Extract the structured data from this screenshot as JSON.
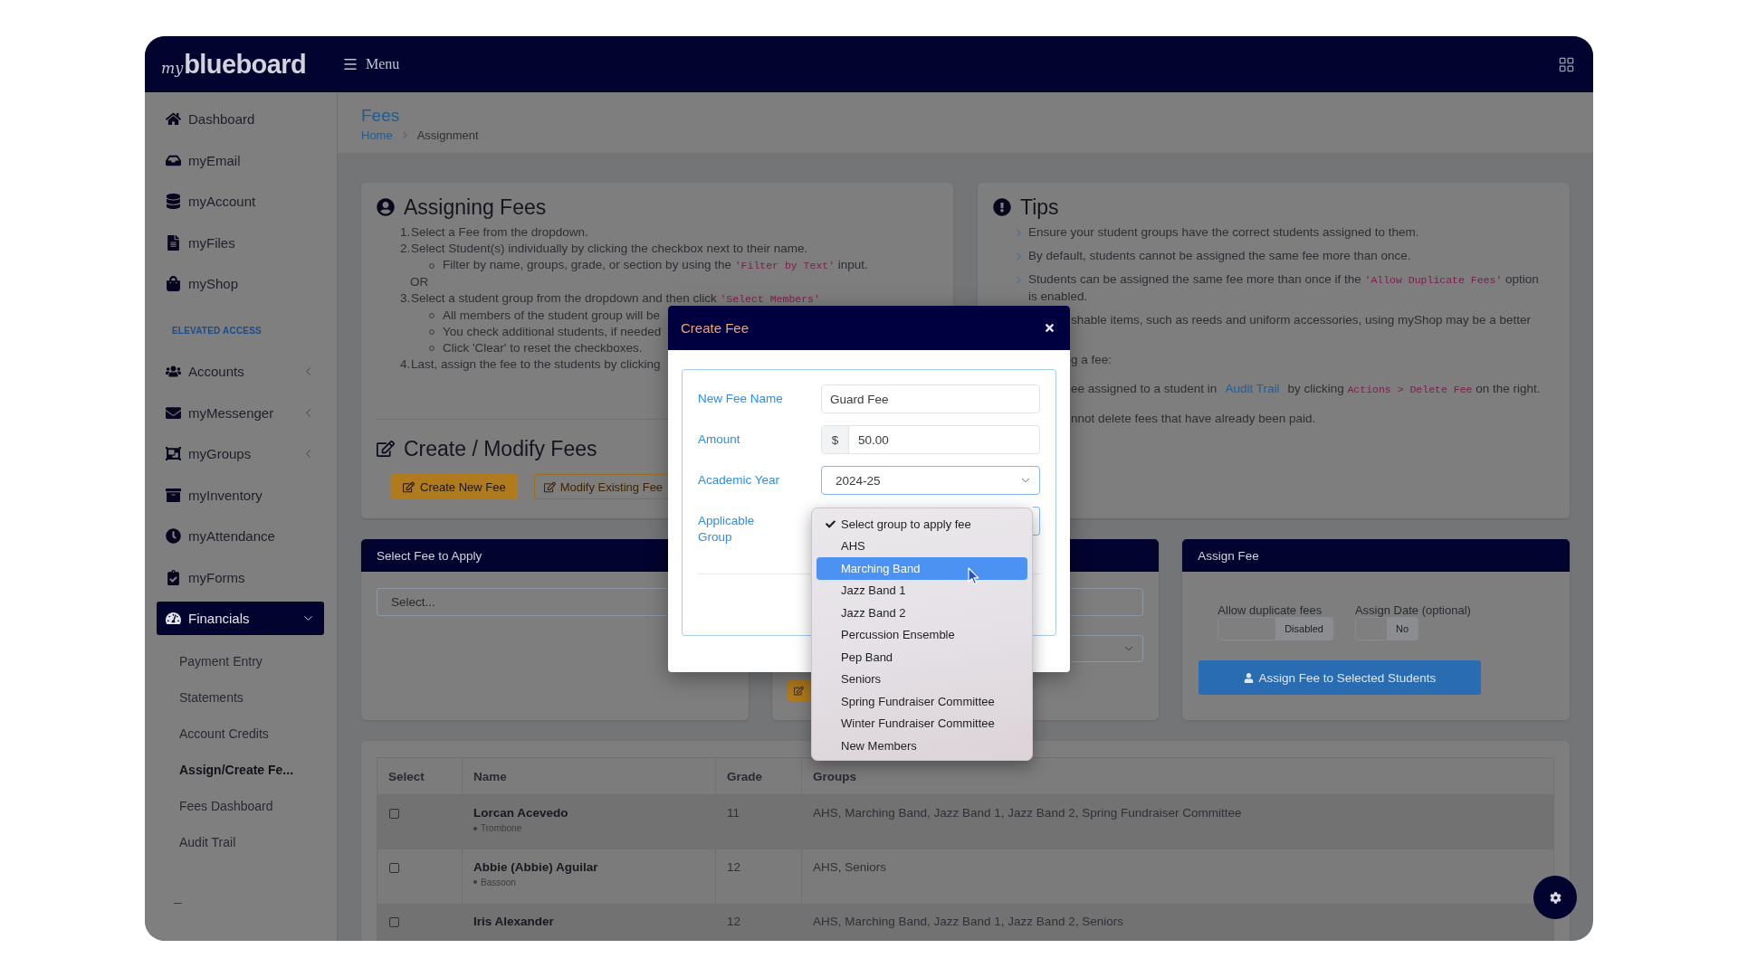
{
  "header": {
    "logo": {
      "prefix": "my",
      "name": "blueboard"
    },
    "menu_label": "Menu"
  },
  "sidebar": {
    "items": [
      {
        "label": "Dashboard",
        "selected": false
      },
      {
        "label": "myEmail",
        "selected": false
      },
      {
        "label": "myAccount",
        "selected": false
      },
      {
        "label": "myFiles",
        "selected": false
      },
      {
        "label": "myShop",
        "selected": false
      }
    ],
    "section_title": "ELEVATED ACCESS",
    "elevated_items": [
      {
        "kind": "menu",
        "label": "Accounts",
        "selected": false,
        "expanded": false
      },
      {
        "kind": "menu",
        "label": "myMessenger",
        "selected": false,
        "expanded": false
      },
      {
        "kind": "menu",
        "label": "myGroups",
        "selected": false,
        "expanded": false
      },
      {
        "kind": "link",
        "label": "myInventory",
        "selected": false
      },
      {
        "kind": "link",
        "label": "myAttendance",
        "selected": false
      },
      {
        "kind": "link",
        "label": "myForms",
        "selected": false
      },
      {
        "kind": "menu",
        "label": "Financials",
        "selected": true,
        "expanded": true,
        "children": [
          {
            "label": "Payment Entry",
            "selected": false
          },
          {
            "label": "Statements",
            "selected": false
          },
          {
            "label": "Account Credits",
            "selected": false
          },
          {
            "label": "Assign/Create Fe...",
            "selected": true
          },
          {
            "label": "Fees Dashboard",
            "selected": false
          },
          {
            "label": "Audit Trail",
            "selected": false
          }
        ]
      }
    ]
  },
  "page": {
    "title": "Fees",
    "breadcrumb": [
      {
        "kind": "link",
        "label": "Home"
      },
      {
        "kind": "current",
        "label": "Assignment"
      }
    ]
  },
  "assigning_fees": {
    "title": "Assigning Fees",
    "steps": [
      {
        "kind": "step",
        "number": "1.",
        "parts": [
          {
            "kind": "text",
            "text": "Select a Fee from the dropdown."
          }
        ]
      },
      {
        "kind": "step",
        "number": "2.",
        "parts": [
          {
            "kind": "text",
            "text": "Select Student(s) individually by clicking the checkbox next to their name."
          }
        ]
      },
      {
        "kind": "sub",
        "parts": [
          {
            "kind": "text",
            "text": "Filter by name, groups, grade, or section by using the "
          },
          {
            "kind": "code",
            "text": "'Filter by Text'"
          },
          {
            "kind": "text",
            "text": " input."
          }
        ]
      },
      {
        "kind": "note",
        "parts": [
          {
            "kind": "text",
            "text": "OR"
          }
        ]
      },
      {
        "kind": "step",
        "number": "3.",
        "parts": [
          {
            "kind": "text",
            "text": "Select a student group from the dropdown and then click "
          },
          {
            "kind": "code",
            "text": "'Select Members'"
          }
        ]
      },
      {
        "kind": "sub",
        "parts": [
          {
            "kind": "text",
            "text": "All members of the student group will be"
          }
        ]
      },
      {
        "kind": "sub",
        "parts": [
          {
            "kind": "text",
            "text": "You check additional students, if needed"
          }
        ]
      },
      {
        "kind": "sub",
        "parts": [
          {
            "kind": "text",
            "text": "Click 'Clear' to reset the checkboxes."
          }
        ]
      },
      {
        "kind": "step",
        "number": "4.",
        "parts": [
          {
            "kind": "text",
            "text": "Last, assign the fee to the students by clicking"
          }
        ]
      }
    ],
    "create_modify": {
      "title": "Create / Modify Fees",
      "buttons": [
        {
          "kind": "solid",
          "label": "Create New Fee"
        },
        {
          "kind": "outline",
          "label": "Modify Existing Fee"
        }
      ]
    }
  },
  "tips": {
    "title": "Tips",
    "items": [
      {
        "kind": "full",
        "parts": [
          {
            "kind": "text",
            "text": "Ensure your student groups have the correct students assigned to them."
          }
        ]
      },
      {
        "kind": "full",
        "parts": [
          {
            "kind": "text",
            "text": "By default, students cannot be assigned the same fee more than once."
          }
        ]
      },
      {
        "kind": "full",
        "parts": [
          {
            "kind": "text",
            "text": "Students can be assigned the same fee more than once if the "
          },
          {
            "kind": "code",
            "text": "'Allow Duplicate Fees'"
          },
          {
            "kind": "text",
            "text": " option is enabled."
          }
        ]
      },
      {
        "kind": "cut",
        "parts": [
          {
            "kind": "text",
            "text": "shable items, such as reeds and uniform accessories, using myShop may be a better"
          }
        ]
      },
      {
        "kind": "cut",
        "parts": [
          {
            "kind": "text",
            "text": "g a fee:"
          }
        ]
      },
      {
        "kind": "cut",
        "parts": [
          {
            "kind": "text",
            "text": "ee assigned to a student in"
          },
          {
            "kind": "link",
            "text": "Audit Trail"
          },
          {
            "kind": "text",
            "text": "by clicking "
          },
          {
            "kind": "code",
            "text": "Actions > Delete Fee"
          },
          {
            "kind": "text",
            "text": " on the right."
          }
        ]
      },
      {
        "kind": "cut",
        "parts": [
          {
            "kind": "text",
            "text": "nnot delete fees that have already been paid."
          }
        ]
      }
    ]
  },
  "select_fee": {
    "title": "Select Fee to Apply",
    "placeholder": "Select..."
  },
  "assign_fee": {
    "title": "Assign Fee",
    "toggles": [
      {
        "label": "Allow duplicate fees",
        "on": false,
        "state_label": "Disabled"
      },
      {
        "label": "Assign Date (optional)",
        "on": false,
        "state_label": "No"
      }
    ],
    "button": "Assign Fee to Selected Students"
  },
  "table": {
    "columns": [
      "Select",
      "Name",
      "Grade",
      "Groups"
    ],
    "rows": [
      {
        "checked": false,
        "name": "Lorcan Acevedo",
        "instrument": "Trombone",
        "grade": "11",
        "groups": "AHS, Marching Band, Jazz Band 1, Jazz Band 2, Spring Fundraiser Committee"
      },
      {
        "checked": false,
        "name": "Abbie (Abbie) Aguilar",
        "instrument": "Bassoon",
        "grade": "12",
        "groups": "AHS, Seniors"
      },
      {
        "checked": false,
        "name": "Iris Alexander",
        "grade": "12",
        "groups": "AHS, Marching Band, Jazz Band 1, Jazz Band 2, Seniors"
      }
    ]
  },
  "modal": {
    "title": "Create Fee",
    "fields": [
      {
        "kind": "text",
        "label": "New Fee Name",
        "value": "Guard Fee"
      },
      {
        "kind": "money",
        "label": "Amount",
        "prefix": "$",
        "value": "50.00"
      },
      {
        "kind": "select",
        "label": "Academic Year",
        "value": "2024-25"
      },
      {
        "kind": "open_select",
        "label": "Applicable Group",
        "options": [
          {
            "label": "Select group to apply fee",
            "selected": true,
            "highlighted": false
          },
          {
            "label": "AHS",
            "selected": false,
            "highlighted": false
          },
          {
            "label": "Marching Band",
            "selected": false,
            "highlighted": true
          },
          {
            "label": "Jazz Band 1",
            "selected": false,
            "highlighted": false
          },
          {
            "label": "Jazz Band 2",
            "selected": false,
            "highlighted": false
          },
          {
            "label": "Percussion Ensemble",
            "selected": false,
            "highlighted": false
          },
          {
            "label": "Pep Band",
            "selected": false,
            "highlighted": false
          },
          {
            "label": "Seniors",
            "selected": false,
            "highlighted": false
          },
          {
            "label": "Spring Fundraiser Committee",
            "selected": false,
            "highlighted": false
          },
          {
            "label": "Winter Fundraiser Committee",
            "selected": false,
            "highlighted": false
          },
          {
            "label": "New Members",
            "selected": false,
            "highlighted": false
          }
        ]
      }
    ]
  }
}
